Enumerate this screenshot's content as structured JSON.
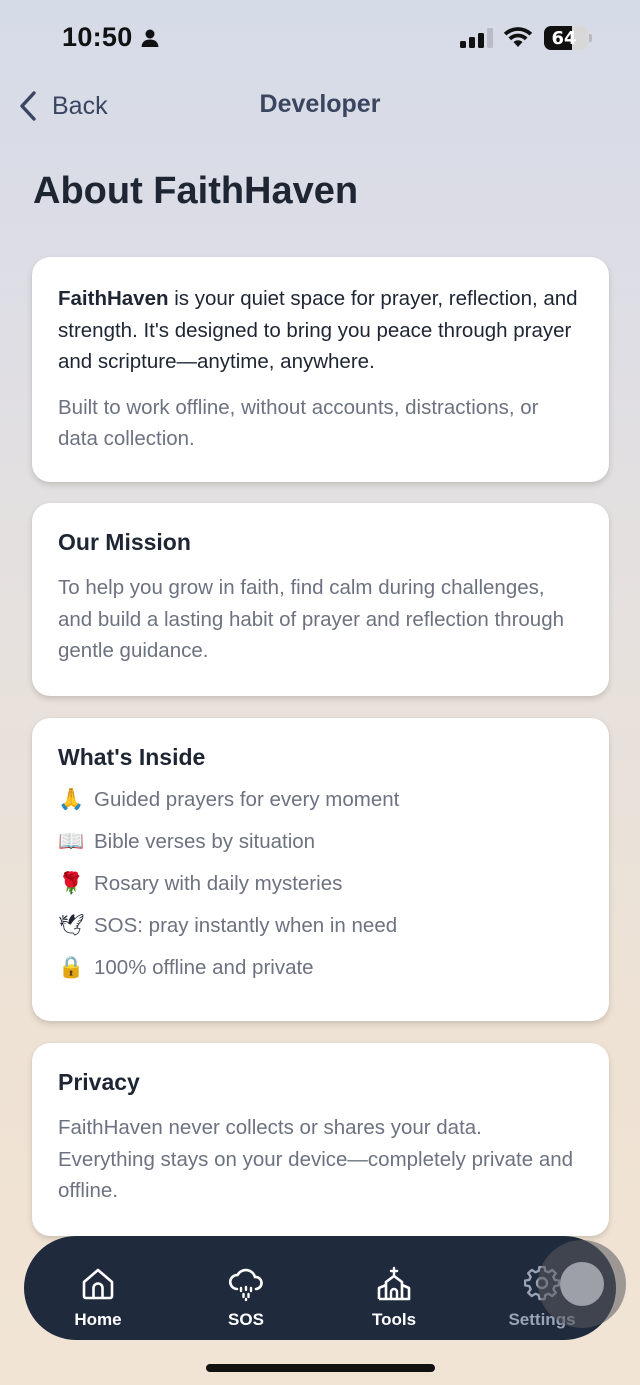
{
  "status_bar": {
    "time": "10:50",
    "battery": 64
  },
  "nav": {
    "back_label": "Back",
    "title": "Developer"
  },
  "page": {
    "title": "About FaithHaven"
  },
  "intro": {
    "brand": "FaithHaven",
    "lead_rest": " is your quiet space for prayer, reflection, and strength. It's designed to bring you peace through prayer and scripture—anytime, anywhere.",
    "note": "Built to work offline, without accounts, distractions, or data collection."
  },
  "mission": {
    "title": "Our Mission",
    "text": "To help you grow in faith, find calm during challenges, and build a lasting habit of prayer and reflection through gentle guidance."
  },
  "inside": {
    "title": "What's Inside",
    "items": [
      {
        "icon": "🙏",
        "text": "Guided prayers for every moment"
      },
      {
        "icon": "📖",
        "text": "Bible verses by situation"
      },
      {
        "icon": "🌹",
        "text": "Rosary with daily mysteries"
      },
      {
        "icon": "🕊",
        "text": "SOS: pray instantly when in need"
      },
      {
        "icon": "🔒",
        "text": "100% offline and private"
      }
    ]
  },
  "privacy": {
    "title": "Privacy",
    "text": "FaithHaven never collects or shares your data. Everything stays on your device—completely private and offline."
  },
  "tabs": [
    {
      "label": "Home",
      "icon": "house-icon"
    },
    {
      "label": "SOS",
      "icon": "cloud-rain-icon"
    },
    {
      "label": "Tools",
      "icon": "church-icon"
    },
    {
      "label": "Settings",
      "icon": "gear-icon"
    }
  ],
  "colors": {
    "tab_bar": "#1f2a3c",
    "active_tab": "#9aa3b8",
    "text_primary": "#1e2533",
    "text_secondary": "#6c7280"
  }
}
